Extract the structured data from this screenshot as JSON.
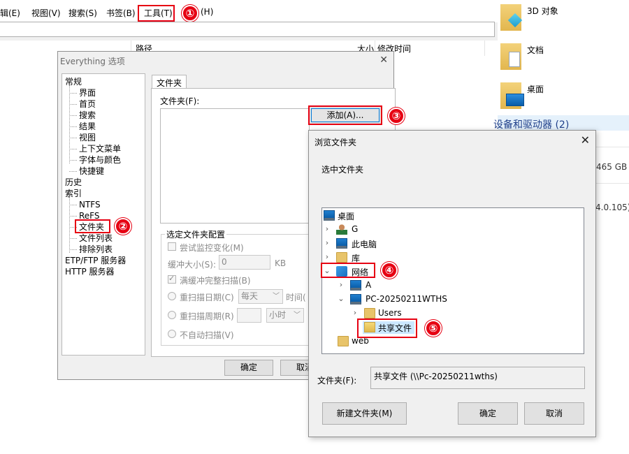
{
  "everything": {
    "menu": [
      "辑(E)",
      "视图(V)",
      "搜索(S)",
      "书签(B)",
      "工具(T)",
      "(H)"
    ],
    "columns": {
      "path": "路径",
      "size": "大小",
      "modified": "修改时间"
    }
  },
  "explorer": {
    "items": [
      "3D 对象",
      "文档",
      "桌面"
    ],
    "section": "设备和驱动器 (2)",
    "disk_free": "465 GB",
    "version_partial": "4.0.105)"
  },
  "options": {
    "title": "Everything 选项",
    "close": "✕",
    "tree": [
      {
        "label": "常规",
        "level": 0
      },
      {
        "label": "界面",
        "level": 1
      },
      {
        "label": "首页",
        "level": 1
      },
      {
        "label": "搜索",
        "level": 1
      },
      {
        "label": "结果",
        "level": 1
      },
      {
        "label": "视图",
        "level": 1
      },
      {
        "label": "上下文菜单",
        "level": 1
      },
      {
        "label": "字体与颜色",
        "level": 1
      },
      {
        "label": "快捷键",
        "level": 1
      },
      {
        "label": "历史",
        "level": 0
      },
      {
        "label": "索引",
        "level": 0
      },
      {
        "label": "NTFS",
        "level": 1
      },
      {
        "label": "ReFS",
        "level": 1
      },
      {
        "label": "文件夹",
        "level": 1
      },
      {
        "label": "文件列表",
        "level": 1
      },
      {
        "label": "排除列表",
        "level": 1
      },
      {
        "label": "ETP/FTP 服务器",
        "level": 0
      },
      {
        "label": "HTTP 服务器",
        "level": 0
      }
    ],
    "tab": "文件夹",
    "folders_label": "文件夹(F):",
    "add_button": "添加(A)...",
    "group_title": "选定文件夹配置",
    "try_monitor": "尝试监控变化(M)",
    "buffer_label": "缓冲大小(S):",
    "buffer_value": "0",
    "buffer_unit": "KB",
    "full_rescan": "满缓冲完整扫描(B)",
    "rescan_daily": "重扫描日期(C)",
    "daily_value": "每天",
    "time_label": "时间(",
    "rescan_period": "重扫描周期(R)",
    "period_unit": "小时",
    "no_auto": "不自动扫描(V)",
    "ok": "确定",
    "cancel": "取消"
  },
  "browse": {
    "title": "浏览文件夹",
    "close": "✕",
    "hint": "选中文件夹",
    "tree": {
      "desktop": "桌面",
      "g": "G",
      "this_pc": "此电脑",
      "library": "库",
      "network": "网络",
      "a": "A",
      "pc": "PC-20250211WTHS",
      "users": "Users",
      "share": "共享文件",
      "web": "web"
    },
    "folder_label": "文件夹(F):",
    "folder_value": "共享文件 (\\\\Pc-20250211wths)",
    "new_folder": "新建文件夹(M)",
    "ok": "确定",
    "cancel": "取消"
  },
  "markers": [
    "①",
    "②",
    "③",
    "④",
    "⑤"
  ]
}
